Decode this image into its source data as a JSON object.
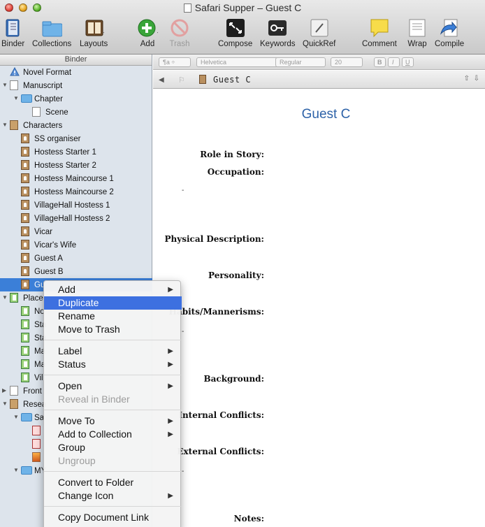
{
  "window": {
    "title": "Safari Supper – Guest C"
  },
  "toolbar": {
    "binder": "Binder",
    "collections": "Collections",
    "layouts": "Layouts",
    "add": "Add",
    "trash": "Trash",
    "compose": "Compose",
    "keywords": "Keywords",
    "quickref": "QuickRef",
    "comment": "Comment",
    "wrap": "Wrap",
    "compile": "Compile"
  },
  "binder": {
    "header": "Binder",
    "items": [
      {
        "label": "Novel Format"
      },
      {
        "label": "Manuscript"
      },
      {
        "label": "Chapter"
      },
      {
        "label": "Scene"
      },
      {
        "label": "Characters"
      },
      {
        "label": "SS organiser"
      },
      {
        "label": "Hostess Starter 1"
      },
      {
        "label": "Hostess Starter 2"
      },
      {
        "label": "Hostess Maincourse 1"
      },
      {
        "label": "Hostess Maincourse 2"
      },
      {
        "label": "VillageHall Hostess 1"
      },
      {
        "label": "VillageHall Hostess 2"
      },
      {
        "label": "Vicar"
      },
      {
        "label": "Vicar's Wife"
      },
      {
        "label": "Guest A"
      },
      {
        "label": "Guest B"
      },
      {
        "label": "Gu"
      },
      {
        "label": "Places"
      },
      {
        "label": "No"
      },
      {
        "label": "Sta"
      },
      {
        "label": "Sta"
      },
      {
        "label": "Ma"
      },
      {
        "label": "Ma"
      },
      {
        "label": "Vil"
      },
      {
        "label": "Front"
      },
      {
        "label": "Resea"
      },
      {
        "label": "Sa"
      },
      {
        "label": ""
      },
      {
        "label": ""
      },
      {
        "label": ""
      },
      {
        "label": "MY"
      }
    ]
  },
  "formatbar": {
    "font": "Helvetica",
    "style": "Regular",
    "size": "20",
    "bold": "B",
    "italic": "I",
    "underline": "U"
  },
  "header": {
    "doc_title": "Guest C"
  },
  "editor": {
    "title": "Guest C",
    "fields": [
      "Role in Story:",
      "Occupation:",
      "Physical Description:",
      "Personality:",
      "Habits/Mannerisms:",
      "Background:",
      "Internal Conflicts:",
      "External Conflicts:",
      "Notes:"
    ],
    "dash": "-"
  },
  "context_menu": {
    "add": "Add",
    "duplicate": "Duplicate",
    "rename": "Rename",
    "move_to_trash": "Move to Trash",
    "label": "Label",
    "status": "Status",
    "open": "Open",
    "reveal_in_binder": "Reveal in Binder",
    "move_to": "Move To",
    "add_to_collection": "Add to Collection",
    "group": "Group",
    "ungroup": "Ungroup",
    "convert_to_folder": "Convert to Folder",
    "change_icon": "Change Icon",
    "copy_document_link": "Copy Document Link"
  },
  "colors": {
    "accent": "#3d70e0",
    "title_blue": "#2d62a8",
    "sidebar": "#dde4ec"
  }
}
